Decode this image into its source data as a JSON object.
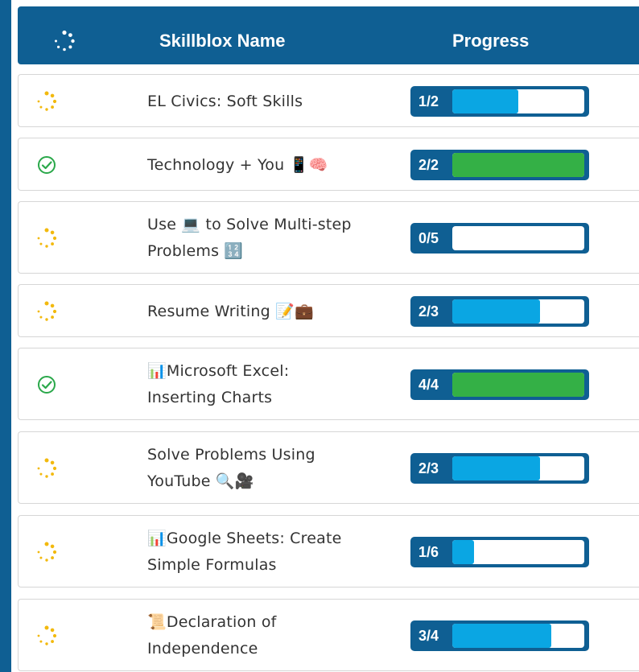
{
  "header": {
    "name_label": "Skillblox Name",
    "progress_label": "Progress"
  },
  "colors": {
    "header_bg": "#0f5f93",
    "in_progress_fill": "#0aa6e3",
    "complete_fill": "#34b046",
    "in_progress_icon": "#f2b90d",
    "complete_icon": "#2aa84a"
  },
  "rows": [
    {
      "status": "in-progress",
      "status_icon": "spinner-icon",
      "lines": [
        "EL Civics: Soft Skills"
      ],
      "count": "1/2",
      "completed": 1,
      "total": 2
    },
    {
      "status": "complete",
      "status_icon": "check-circle-icon",
      "lines": [
        "Technology + You 📱🧠"
      ],
      "count": "2/2",
      "completed": 2,
      "total": 2
    },
    {
      "status": "in-progress",
      "status_icon": "spinner-icon",
      "lines": [
        "Use 💻 to Solve Multi-step",
        "Problems 🔢"
      ],
      "count": "0/5",
      "completed": 0,
      "total": 5
    },
    {
      "status": "in-progress",
      "status_icon": "spinner-icon",
      "lines": [
        "Resume Writing 📝💼"
      ],
      "count": "2/3",
      "completed": 2,
      "total": 3
    },
    {
      "status": "complete",
      "status_icon": "check-circle-icon",
      "lines": [
        "📊Microsoft Excel:",
        "Inserting Charts"
      ],
      "count": "4/4",
      "completed": 4,
      "total": 4
    },
    {
      "status": "in-progress",
      "status_icon": "spinner-icon",
      "lines": [
        "Solve Problems Using",
        "YouTube 🔍🎥"
      ],
      "count": "2/3",
      "completed": 2,
      "total": 3
    },
    {
      "status": "in-progress",
      "status_icon": "spinner-icon",
      "lines": [
        "📊Google Sheets: Create",
        "Simple Formulas"
      ],
      "count": "1/6",
      "completed": 1,
      "total": 6
    },
    {
      "status": "in-progress",
      "status_icon": "spinner-icon",
      "lines": [
        "📜Declaration of",
        "Independence"
      ],
      "count": "3/4",
      "completed": 3,
      "total": 4
    }
  ]
}
